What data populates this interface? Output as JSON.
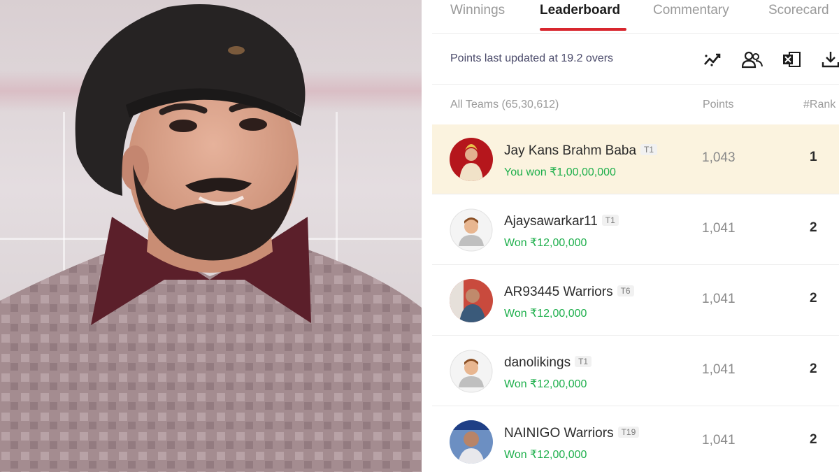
{
  "tabs": [
    {
      "label": "Winnings",
      "active": false
    },
    {
      "label": "Leaderboard",
      "active": true
    },
    {
      "label": "Commentary",
      "active": false
    },
    {
      "label": "Scorecard",
      "active": false
    }
  ],
  "status": {
    "updated_text": "Points last updated at 19.2 overs"
  },
  "toolbar": {
    "icons": [
      "trend-icon",
      "compare-teams-icon",
      "excel-icon",
      "download-icon"
    ]
  },
  "columns": {
    "teams": "All Teams (65,30,612)",
    "points": "Points",
    "rank": "#Rank"
  },
  "rows": [
    {
      "name": "Jay Kans Brahm Baba",
      "team": "T1",
      "won": "You won ₹1,00,00,000",
      "points": "1,043",
      "rank": "1",
      "highlight": true
    },
    {
      "name": "Ajaysawarkar11",
      "team": "T1",
      "won": "Won ₹12,00,000",
      "points": "1,041",
      "rank": "2",
      "highlight": false
    },
    {
      "name": "AR93445 Warriors",
      "team": "T6",
      "won": "Won ₹12,00,000",
      "points": "1,041",
      "rank": "2",
      "highlight": false
    },
    {
      "name": "danolikings",
      "team": "T1",
      "won": "Won ₹12,00,000",
      "points": "1,041",
      "rank": "2",
      "highlight": false
    },
    {
      "name": "NAINIGO Warriors",
      "team": "T19",
      "won": "Won ₹12,00,000",
      "points": "1,041",
      "rank": "2",
      "highlight": false
    }
  ],
  "colors": {
    "accent": "#d8262e",
    "won_green": "#1eaf4c",
    "highlight_row": "#fbf3df"
  }
}
